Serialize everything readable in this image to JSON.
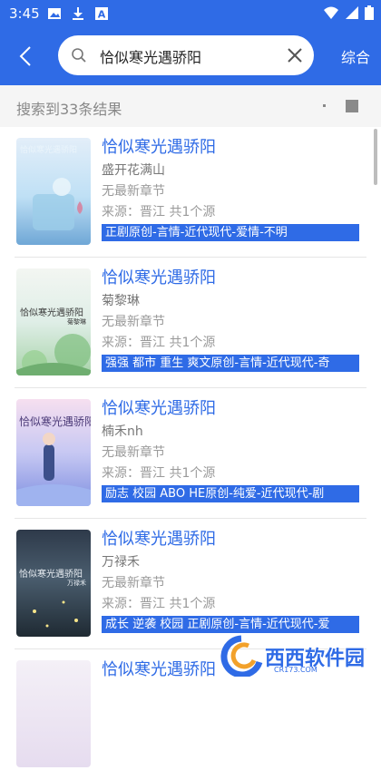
{
  "status_bar": {
    "time": "3:45",
    "icons": [
      "image-icon",
      "download-icon",
      "a-icon",
      "wifi-icon",
      "signal-icon",
      "battery-icon"
    ]
  },
  "toolbar": {
    "query": "恰似寒光遇骄阳",
    "filter_label": "综合",
    "accent": "#2f6be6"
  },
  "result_header": {
    "count_text": "搜索到33条结果"
  },
  "results": [
    {
      "title": "恰似寒光遇骄阳",
      "author": "盛开花满山",
      "latest": "无最新章节",
      "source": "来源：晋江  共1个源",
      "tags": "正剧原创-言情-近代现代-爱情-不明",
      "cover_text": "恰似寒光遇骄阳"
    },
    {
      "title": "恰似寒光遇骄阳",
      "author": "菊黎琳",
      "latest": "无最新章节",
      "source": "来源：晋江  共1个源",
      "tags": "强强 都市 重生 爽文原创-言情-近代现代-奇",
      "cover_text": "恰似寒光遇骄阳",
      "cover_author": "菊黎琳"
    },
    {
      "title": "恰似寒光遇骄阳",
      "author": "楠禾nh",
      "latest": "无最新章节",
      "source": "来源：晋江  共1个源",
      "tags": "励志 校园 ABO HE原创-纯爱-近代现代-剧",
      "cover_text": "恰似寒光遇骄阳"
    },
    {
      "title": "恰似寒光遇骄阳",
      "author": "万禄禾",
      "latest": "无最新章节",
      "source": "来源：晋江  共1个源",
      "tags": "成长 逆袭 校园 正剧原创-言情-近代现代-爱",
      "cover_text": "恰似寒光遇骄阳",
      "cover_author": "万禄禾"
    },
    {
      "title": "恰似寒光遇骄阳",
      "author": "",
      "latest": "",
      "source": "",
      "tags": ""
    }
  ],
  "watermark": {
    "text": "西西软件园",
    "sub": "CR173.COM"
  }
}
